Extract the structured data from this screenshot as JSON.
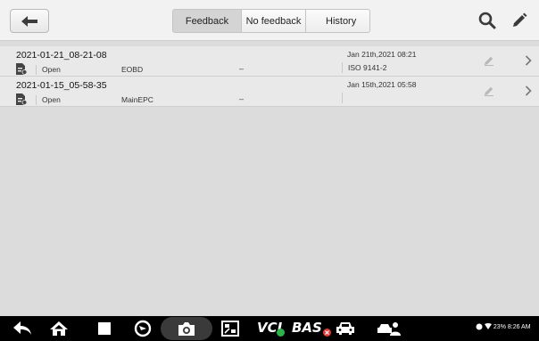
{
  "toolbar": {
    "tabs": [
      {
        "label": "Feedback",
        "active": true
      },
      {
        "label": "No feedback",
        "active": false
      },
      {
        "label": "History",
        "active": false
      }
    ]
  },
  "records": [
    {
      "name": "2021-01-21_08-21-08",
      "status": "Open",
      "module": "EOBD",
      "dash": "–",
      "date": "Jan 21th,2021 08:21",
      "protocol": "ISO 9141-2"
    },
    {
      "name": "2021-01-15_05-58-35",
      "status": "Open",
      "module": "MainEPC",
      "dash": "–",
      "date": "Jan 15th,2021 05:58",
      "protocol": ""
    }
  ],
  "navbar": {
    "vci_label": "VCI",
    "bas_label": "BAS",
    "status_text": "23% 8:26 AM"
  },
  "icons": {
    "back": "back-arrow-icon",
    "search": "search-icon",
    "edit": "pencil-icon",
    "row_doc": "document-icon",
    "row_edit": "pencil-icon",
    "row_chevron": "chevron-right-icon"
  },
  "colors": {
    "toolbar_bg": "#f2f2f2",
    "row_bg": "#e9e9e9",
    "content_bg": "#dcdcdc",
    "navbar_bg": "#000000",
    "vci_badge": "#2db34a",
    "bas_badge": "#e53935"
  }
}
